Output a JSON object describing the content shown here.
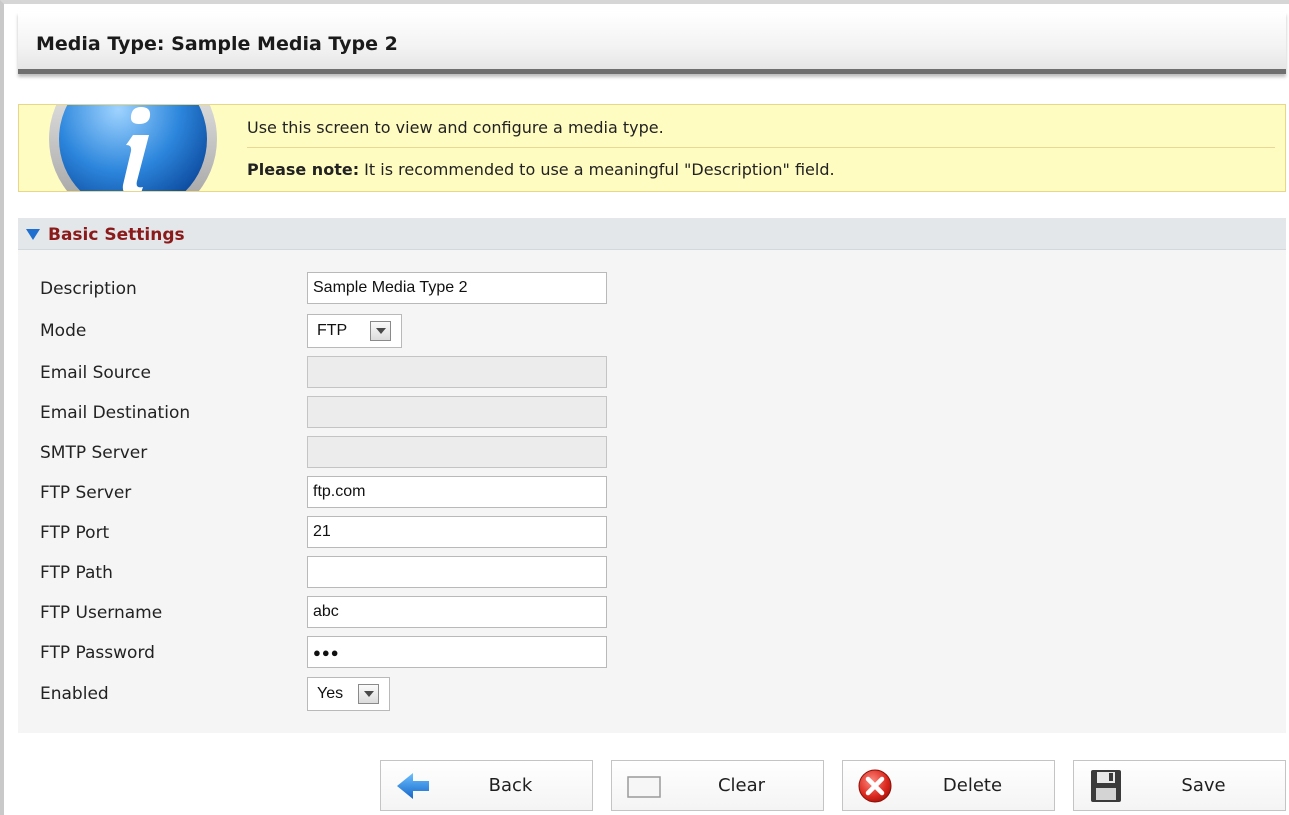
{
  "page": {
    "title": "Media Type: Sample Media Type 2"
  },
  "info": {
    "line1": "Use this screen to view and configure a media type.",
    "note_label": "Please note:",
    "note_text": " It is recommended to use a meaningful \"Description\" field."
  },
  "section": {
    "title": "Basic Settings"
  },
  "fields": {
    "description": {
      "label": "Description",
      "value": "Sample Media Type 2"
    },
    "mode": {
      "label": "Mode",
      "value": "FTP"
    },
    "email_source": {
      "label": "Email Source",
      "value": ""
    },
    "email_destination": {
      "label": "Email Destination",
      "value": ""
    },
    "smtp_server": {
      "label": "SMTP Server",
      "value": ""
    },
    "ftp_server": {
      "label": "FTP Server",
      "value": "ftp.com"
    },
    "ftp_port": {
      "label": "FTP Port",
      "value": "21"
    },
    "ftp_path": {
      "label": "FTP Path",
      "value": ""
    },
    "ftp_username": {
      "label": "FTP Username",
      "value": "abc"
    },
    "ftp_password": {
      "label": "FTP Password",
      "value": "●●●"
    },
    "enabled": {
      "label": "Enabled",
      "value": "Yes"
    }
  },
  "buttons": {
    "back": "Back",
    "clear": "Clear",
    "delete": "Delete",
    "save": "Save"
  },
  "icons": {
    "info": "info-icon",
    "back": "arrow-left-icon",
    "clear": "blank-rectangle-icon",
    "delete": "red-x-circle-icon",
    "save": "floppy-disk-icon"
  },
  "colors": {
    "info_background": "#fffcc2",
    "section_title": "#8b1a1a",
    "section_arrow": "#1f6fd0",
    "delete_red": "#d9261c",
    "back_blue": "#1e7ed8"
  }
}
